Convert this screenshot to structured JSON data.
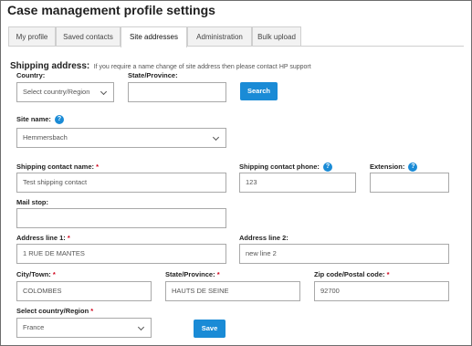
{
  "page": {
    "title": "Case management profile settings"
  },
  "tabs": [
    {
      "label": "My profile",
      "active": false
    },
    {
      "label": "Saved contacts",
      "active": false
    },
    {
      "label": "Site addresses",
      "active": true
    },
    {
      "label": "Administration",
      "active": false
    },
    {
      "label": "Bulk upload",
      "active": false
    }
  ],
  "shipping": {
    "heading": "Shipping address:",
    "note": "If you require a name change of site address then please contact HP support"
  },
  "search": {
    "country_label": "Country:",
    "country_value": "Select country/Region",
    "state_label": "State/Province:",
    "state_value": "",
    "button_label": "Search"
  },
  "site": {
    "label": "Site name:",
    "value": "Hemmersbach"
  },
  "contact": {
    "name_label": "Shipping contact name:",
    "name_value": "Test shipping contact",
    "phone_label": "Shipping contact phone:",
    "phone_value": "123",
    "extension_label": "Extension:",
    "extension_value": "",
    "mailstop_label": "Mail stop:",
    "mailstop_value": ""
  },
  "address": {
    "line1_label": "Address line 1:",
    "line1_value": "1 RUE DE MANTES",
    "line2_label": "Address line 2:",
    "line2_value": "new line 2",
    "city_label": "City/Town:",
    "city_value": "COLOMBES",
    "state_label": "State/Province:",
    "state_value": "HAUTS DE SEINE",
    "zip_label": "Zip code/Postal code:",
    "zip_value": "92700",
    "country_label": "Select country/Region",
    "country_value": "France"
  },
  "actions": {
    "save_label": "Save"
  },
  "symbols": {
    "required": "*",
    "help": "?"
  },
  "colors": {
    "accent": "#1a8bd6",
    "required": "#d0021b"
  }
}
